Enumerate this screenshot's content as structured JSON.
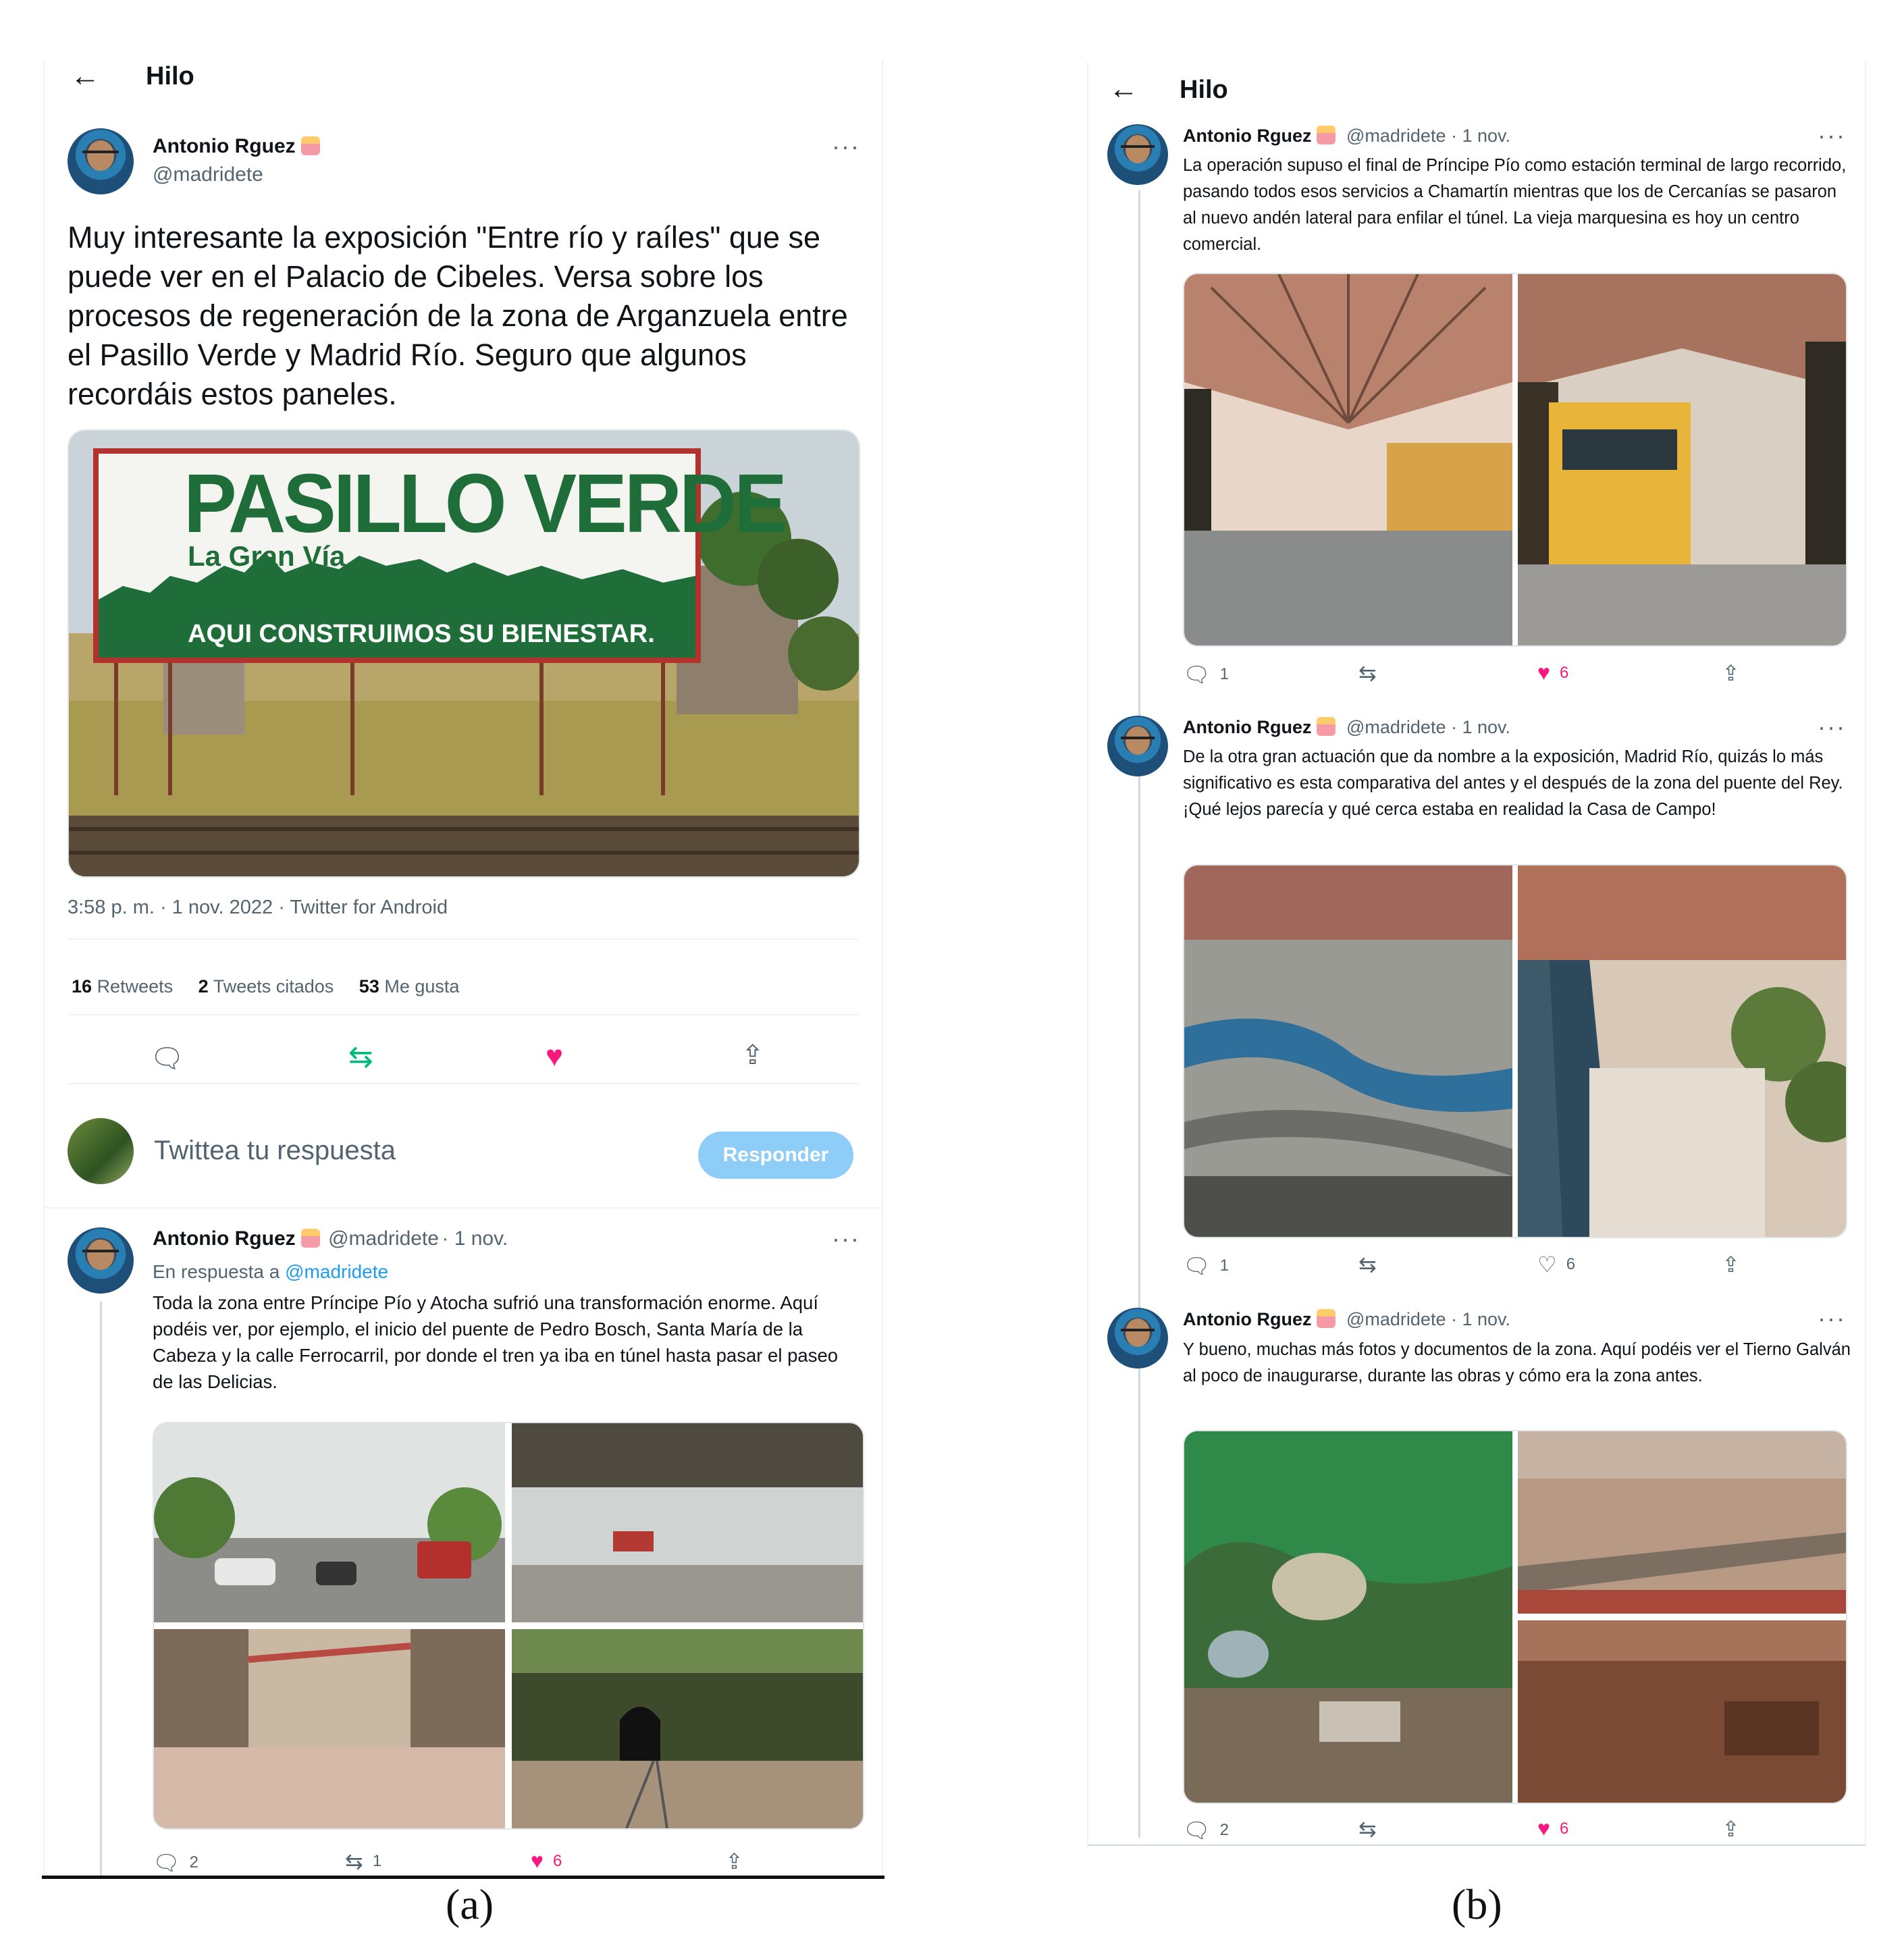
{
  "panel_a": {
    "header": {
      "back_icon": "arrow-left-icon",
      "title": "Hilo"
    },
    "main_tweet": {
      "author_name": "Antonio Rguez",
      "author_handle": "@madridete",
      "text": "Muy interesante la exposición \"Entre río y raíles\" que se puede ver en el Palacio de Cibeles. Versa sobre los procesos de regeneración de la zona de Arganzuela entre el Pasillo Verde y Madrid Río. Seguro que algunos recordáis estos paneles.",
      "billboard_title": "PASILLO VERDE",
      "billboard_subtitle": "La Gran Vía",
      "billboard_slogan": "AQUI CONSTRUIMOS SU BIENESTAR.",
      "timestamp": "3:58 p. m. · 1 nov. 2022 · Twitter for Android",
      "stats": [
        {
          "count": "16",
          "label": "Retweets"
        },
        {
          "count": "2",
          "label": "Tweets citados"
        },
        {
          "count": "53",
          "label": "Me gusta"
        }
      ]
    },
    "compose": {
      "placeholder": "Twittea tu respuesta",
      "button": "Responder"
    },
    "reply_tweet": {
      "author_name": "Antonio Rguez",
      "author_handle": "@madridete",
      "date": "· 1 nov.",
      "reply_to_prefix": "En respuesta a",
      "reply_to_handle": "@madridete",
      "text": "Toda la zona entre Príncipe Pío y Atocha sufrió una transformación enorme. Aquí podéis ver, por ejemplo, el inicio del puente de Pedro Bosch, Santa María de la Cabeza y la calle Ferrocarril, por donde el tren ya iba en túnel hasta pasar el paseo de las Delicias.",
      "actions": {
        "replies": "2",
        "retweets": "1",
        "likes": "6"
      }
    },
    "caption": "(a)"
  },
  "panel_b": {
    "header": {
      "back_icon": "arrow-left-icon",
      "title": "Hilo"
    },
    "tweets": [
      {
        "author_name": "Antonio Rguez",
        "author_handle": "@madridete",
        "date": "· 1 nov.",
        "text": "La operación supuso el final de Príncipe Pío como estación terminal de largo recorrido, pasando todos esos servicios a Chamartín mientras que los de Cercanías se pasaron al nuevo andén lateral para enfilar el túnel. La vieja marquesina es hoy un centro comercial.",
        "actions": {
          "replies": "1",
          "retweets": "",
          "likes": "6",
          "liked": true
        }
      },
      {
        "author_name": "Antonio Rguez",
        "author_handle": "@madridete",
        "date": "· 1 nov.",
        "text": "De la otra gran actuación que da nombre a la exposición, Madrid Río, quizás lo más significativo es esta comparativa del antes y el después de la zona del puente del Rey. ¡Qué lejos parecía y qué cerca estaba en realidad la Casa de Campo!",
        "actions": {
          "replies": "1",
          "retweets": "",
          "likes": "6",
          "liked": false
        }
      },
      {
        "author_name": "Antonio Rguez",
        "author_handle": "@madridete",
        "date": "· 1 nov.",
        "text": "Y bueno, muchas más fotos y documentos de la zona. Aquí podéis ver el Tierno Galván al poco de inaugurarse, durante las obras y cómo era la zona antes.",
        "actions": {
          "replies": "2",
          "retweets": "",
          "likes": "6",
          "liked": true
        }
      }
    ],
    "caption": "(b)"
  },
  "colors": {
    "accent": "#1d9bf0",
    "like": "#f91880",
    "retweet": "#00ba7c",
    "muted": "#536471",
    "billboard_green": "#1f6e3a"
  }
}
